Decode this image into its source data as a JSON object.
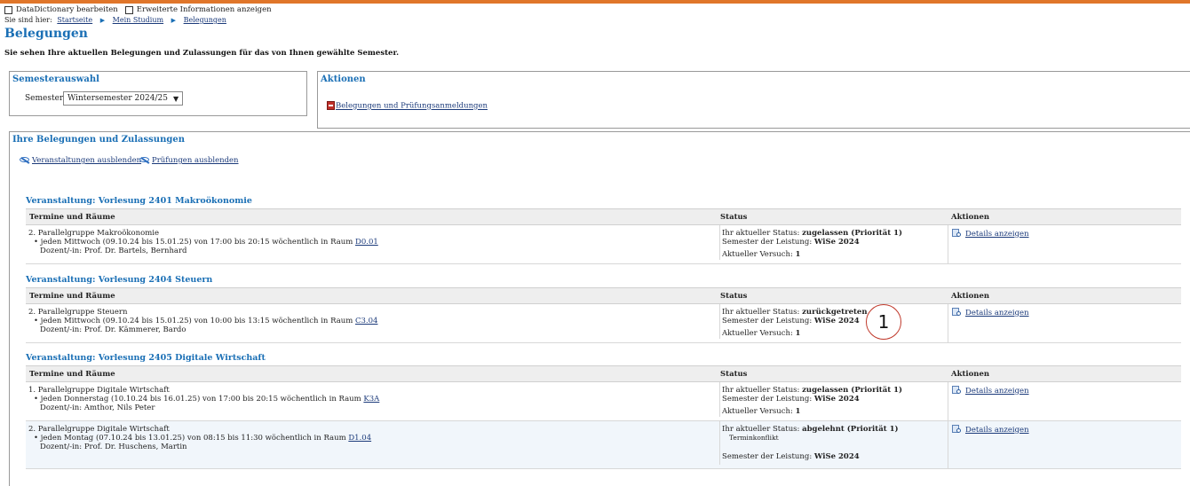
{
  "toolbar": {
    "edit_datadictionary": "DataDictionary bearbeiten",
    "extended_info": "Erweiterte Informationen anzeigen"
  },
  "breadcrumb": {
    "prefix": "Sie sind hier:",
    "items": [
      "Startseite",
      "Mein Studium",
      "Belegungen"
    ]
  },
  "page": {
    "title": "Belegungen",
    "intro": "Sie sehen Ihre aktuellen Belegungen und Zulassungen für das von Ihnen gewählte Semester."
  },
  "semester_box": {
    "title": "Semesterauswahl",
    "label": "Semester",
    "selected": "Wintersemester 2024/25"
  },
  "actions_box": {
    "title": "Aktionen",
    "pdf_link": "Belegungen und Prüfungsanmeldungen"
  },
  "enrollments": {
    "title": "Ihre Belegungen und Zulassungen",
    "hide_courses": "Veranstaltungen ausblenden",
    "hide_exams": "Prüfungen ausblenden",
    "headers": {
      "dates": "Termine und Räume",
      "status": "Status",
      "actions": "Aktionen"
    },
    "courses": [
      {
        "title": "Veranstaltung: Vorlesung 2401 Makroökonomie",
        "rows": [
          {
            "group": "2. Parallelgruppe Makroökonomie",
            "schedule": "jeden Mittwoch (09.10.24 bis 15.01.25) von 17:00 bis 20:15 wöchentlich in Raum",
            "room": "D0.01",
            "lecturer": "Dozent/-in: Prof. Dr. Bartels, Bernhard",
            "status_label": "Ihr aktueller Status:",
            "status_value": "zugelassen (Priorität 1)",
            "semester_label": "Semester der Leistung:",
            "semester_value": "WiSe 2024",
            "attempt_label": "Aktueller Versuch:",
            "attempt_value": "1",
            "action": "Details anzeigen"
          }
        ]
      },
      {
        "title": "Veranstaltung: Vorlesung 2404 Steuern",
        "rows": [
          {
            "group": "2. Parallelgruppe Steuern",
            "schedule": "jeden Mittwoch (09.10.24 bis 15.01.25) von 10:00 bis 13:15 wöchentlich in Raum",
            "room": "C3.04",
            "lecturer": "Dozent/-in: Prof. Dr. Kämmerer, Bardo",
            "status_label": "Ihr aktueller Status:",
            "status_value": "zurückgetreten",
            "semester_label": "Semester der Leistung:",
            "semester_value": "WiSe 2024",
            "attempt_label": "Aktueller Versuch:",
            "attempt_value": "1",
            "action": "Details anzeigen"
          }
        ]
      },
      {
        "title": "Veranstaltung: Vorlesung 2405 Digitale Wirtschaft",
        "rows": [
          {
            "group": "1. Parallelgruppe Digitale Wirtschaft",
            "schedule": "jeden Donnerstag (10.10.24 bis 16.01.25) von 17:00 bis 20:15 wöchentlich in Raum",
            "room": "K3A",
            "lecturer": "Dozent/-in: Amthor, Nils Peter",
            "status_label": "Ihr aktueller Status:",
            "status_value": "zugelassen (Priorität 1)",
            "semester_label": "Semester der Leistung:",
            "semester_value": "WiSe 2024",
            "attempt_label": "Aktueller Versuch:",
            "attempt_value": "1",
            "action": "Details anzeigen"
          },
          {
            "group": "2. Parallelgruppe Digitale Wirtschaft",
            "schedule": "jeden Montag (07.10.24 bis 13.01.25) von 08:15 bis 11:30 wöchentlich in Raum",
            "room": "D1.04",
            "lecturer": "Dozent/-in: Prof. Dr. Huschens, Martin",
            "status_label": "Ihr aktueller Status:",
            "status_value": "abgelehnt (Priorität 1)",
            "reason": "Terminkonflikt",
            "semester_label": "Semester der Leistung:",
            "semester_value": "WiSe 2024",
            "action": "Details anzeigen"
          }
        ]
      }
    ]
  },
  "annotation": {
    "marker": "1"
  },
  "colors": {
    "accent": "#1a6fb5",
    "topbar": "#e0762a",
    "annotation_circle": "#c0392b"
  }
}
